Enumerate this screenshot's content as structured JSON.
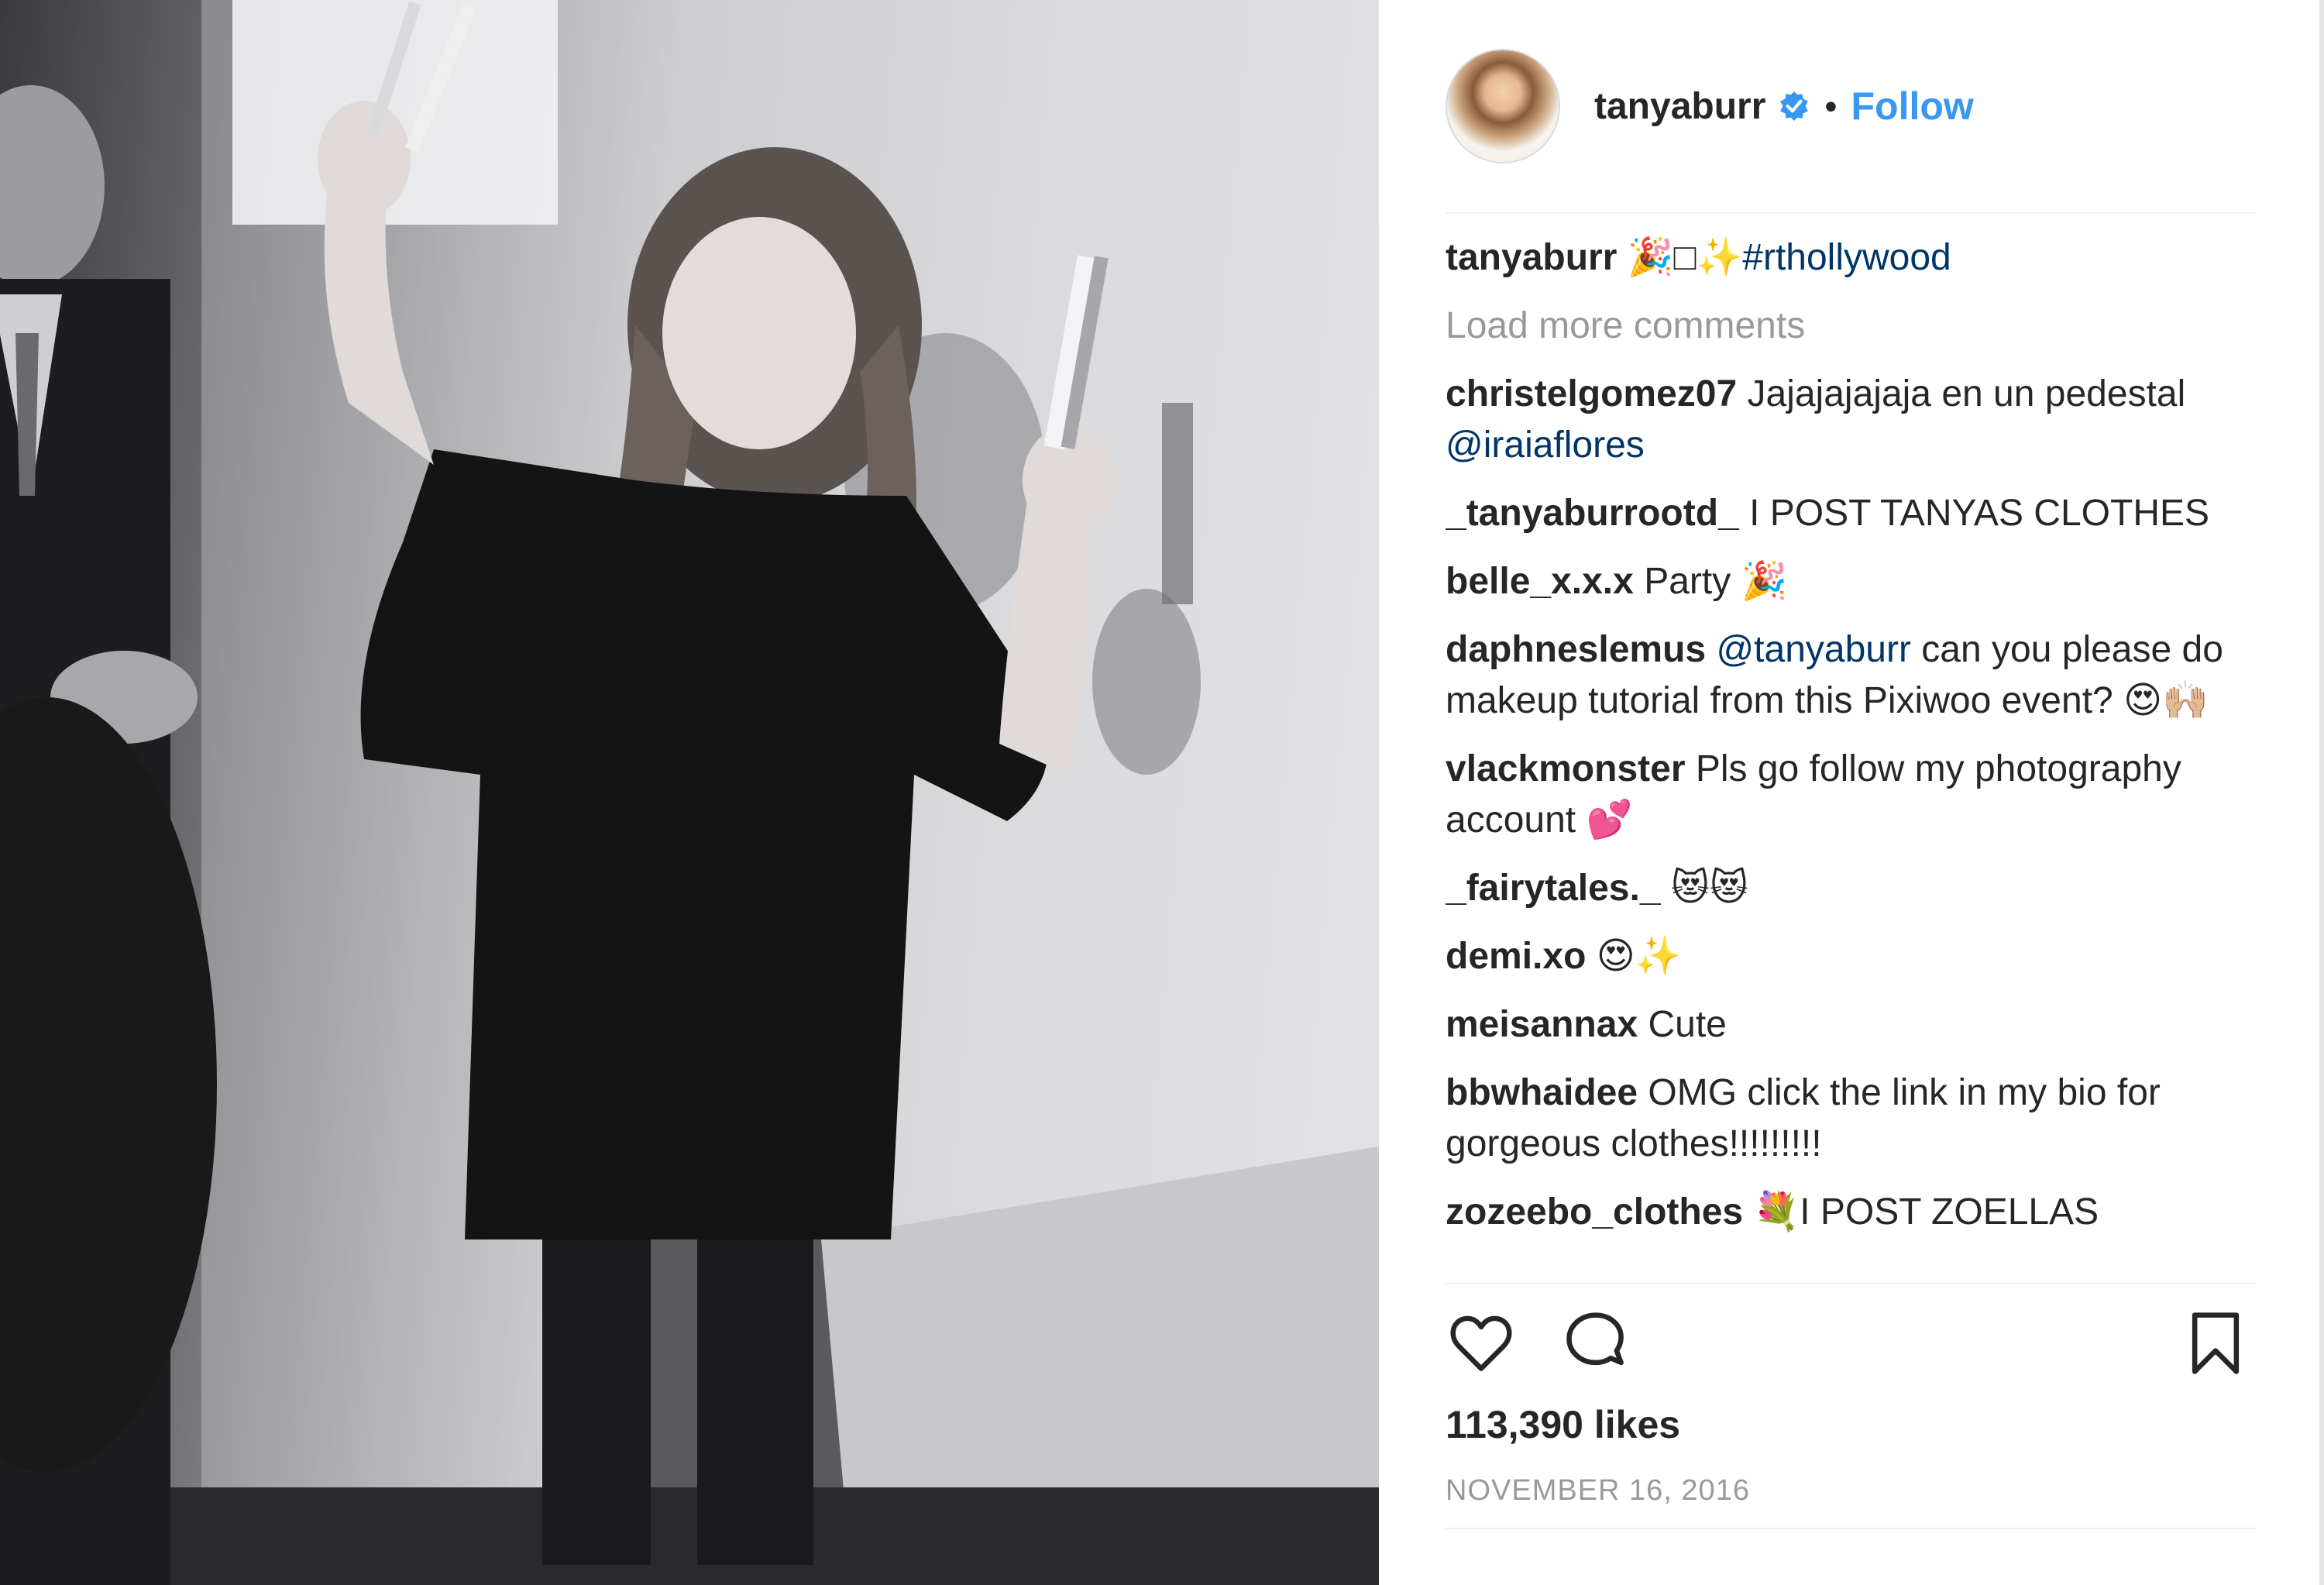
{
  "header": {
    "username": "tanyaburr",
    "separator": "•",
    "follow_label": "Follow"
  },
  "caption": {
    "user": "tanyaburr",
    "emoji": "🎉□✨",
    "hashtag": "#rthollywood"
  },
  "load_more_label": "Load more comments",
  "comments": [
    {
      "user": "christelgomez07",
      "text": "Jajajajajaja en un pedestal",
      "mention": "@iraiaflores",
      "after": ""
    },
    {
      "user": "_tanyaburrootd_",
      "text": "I POST TANYAS CLOTHES",
      "mention": "",
      "after": ""
    },
    {
      "user": "belle_x.x.x",
      "text": "Party 🎉",
      "mention": "",
      "after": ""
    },
    {
      "user": "daphneslemus",
      "text": "",
      "mention": "@tanyaburr",
      "after": "can you please do makeup tutorial from this Pixiwoo event? 😍🙌🏼"
    },
    {
      "user": "vlackmonster",
      "text": "Pls go follow my photography account 💕",
      "mention": "",
      "after": ""
    },
    {
      "user": "_fairytales._",
      "text": "😻😻",
      "mention": "",
      "after": ""
    },
    {
      "user": "demi.xo",
      "text": "😍✨",
      "mention": "",
      "after": ""
    },
    {
      "user": "meisannax",
      "text": "Cute",
      "mention": "",
      "after": ""
    },
    {
      "user": "bbwhaidee",
      "text": "OMG click the link in my bio for gorgeous clothes!!!!!!!!!",
      "mention": "",
      "after": ""
    },
    {
      "user": "zozeebo_clothes",
      "text": "💐I POST ZOELLAS",
      "mention": "",
      "after": ""
    }
  ],
  "likes_label": "113,390 likes",
  "date_label": "NOVEMBER 16, 2016",
  "icons": {
    "verified": "verified-badge-icon",
    "like": "heart-icon",
    "comment": "speech-bubble-icon",
    "save": "bookmark-icon"
  },
  "colors": {
    "link": "#3897f0",
    "mention": "#003569",
    "muted": "#999999",
    "text": "#262626"
  }
}
